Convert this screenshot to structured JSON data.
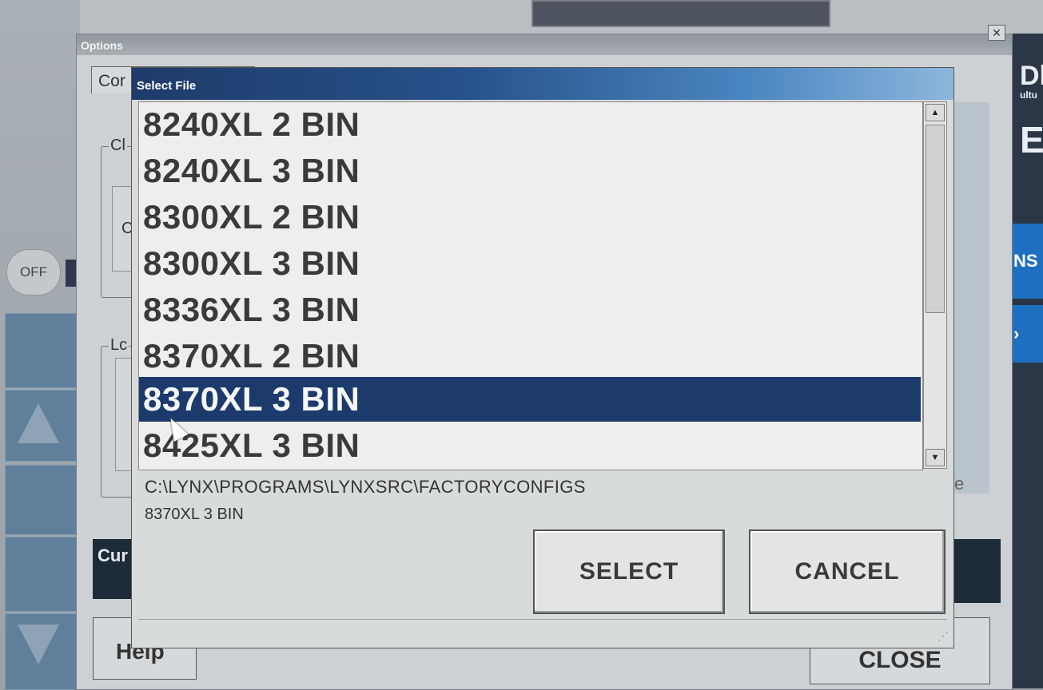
{
  "background": {
    "off_label": "OFF",
    "right_partial": [
      "Dl",
      "ultu",
      "E",
      "NS",
      "›"
    ]
  },
  "options_window": {
    "title": "Options",
    "close_glyph": "✕",
    "tab_label": "Cor",
    "groups": [
      {
        "label": "Cl"
      },
      {
        "label": "Lc"
      }
    ],
    "inner_box_glyph": "C",
    "cur_label": "Cur",
    "help_label": "Help",
    "close_button_label": "CLOSE",
    "right_partial_text": "e"
  },
  "dialog": {
    "title": "Select File",
    "items": [
      "8240XL 2 BIN",
      "8240XL 3 BIN",
      "8300XL 2 BIN",
      "8300XL 3 BIN",
      "8336XL 3 BIN",
      "8370XL 2 BIN",
      "8370XL 3 BIN",
      "8425XL 3 BIN"
    ],
    "selected_index": 6,
    "path": "C:\\LYNX\\PROGRAMS\\LYNXSRC\\FACTORYCONFIGS",
    "selected_file": "8370XL 3 BIN",
    "select_label": "SELECT",
    "cancel_label": "CANCEL",
    "scroll_up": "▲",
    "scroll_down": "▼",
    "resize_grip": "⋰"
  },
  "colors": {
    "selection": "#1c3a6b",
    "title_bar": "#1e3b69"
  }
}
